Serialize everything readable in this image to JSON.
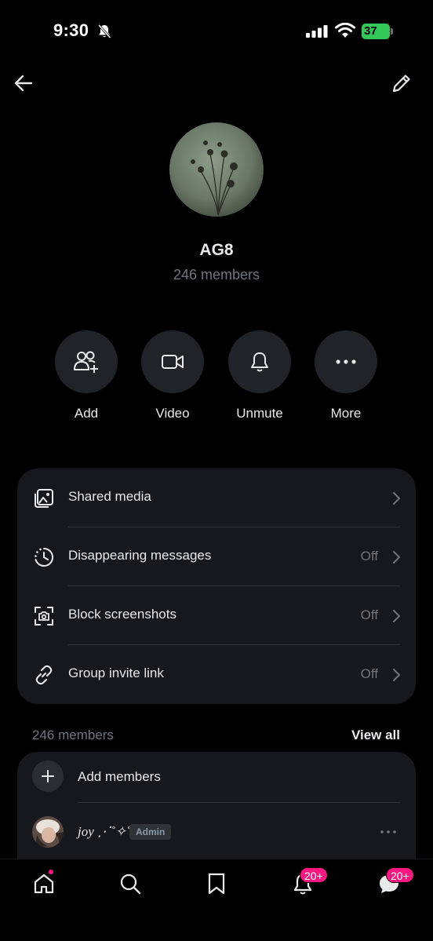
{
  "status_bar": {
    "time": "9:30",
    "battery": "37"
  },
  "nav": {
    "back_icon": "arrow-left-icon",
    "edit_icon": "pencil-icon"
  },
  "group": {
    "name": "AG8",
    "members_count": "246 members"
  },
  "actions": [
    {
      "label": "Add",
      "icon": "add-people-icon"
    },
    {
      "label": "Video",
      "icon": "video-camera-icon"
    },
    {
      "label": "Unmute",
      "icon": "bell-icon"
    },
    {
      "label": "More",
      "icon": "more-dots-icon"
    }
  ],
  "settings": [
    {
      "label": "Shared media",
      "value": "",
      "icon": "image-gallery-icon"
    },
    {
      "label": "Disappearing messages",
      "value": "Off",
      "icon": "timer-icon"
    },
    {
      "label": "Block screenshots",
      "value": "Off",
      "icon": "screenshot-camera-icon"
    },
    {
      "label": "Group invite link",
      "value": "Off",
      "icon": "link-icon"
    }
  ],
  "members": {
    "header": "246 members",
    "view_all": "View all",
    "add_label": "Add members",
    "list": [
      {
        "name": "joy ⋰˚✧˚⋰",
        "badge": "Admin"
      }
    ]
  },
  "tab_bar": {
    "items": [
      "home-icon",
      "search-icon",
      "bookmark-icon",
      "notifications-icon",
      "messages-icon"
    ],
    "notifications_badge": "20+",
    "messages_badge": "20+"
  },
  "colors": {
    "background": "#000000",
    "card": "#16181c",
    "accent_badge": "#f91880",
    "battery": "#34c759",
    "muted_text": "#71767b"
  }
}
